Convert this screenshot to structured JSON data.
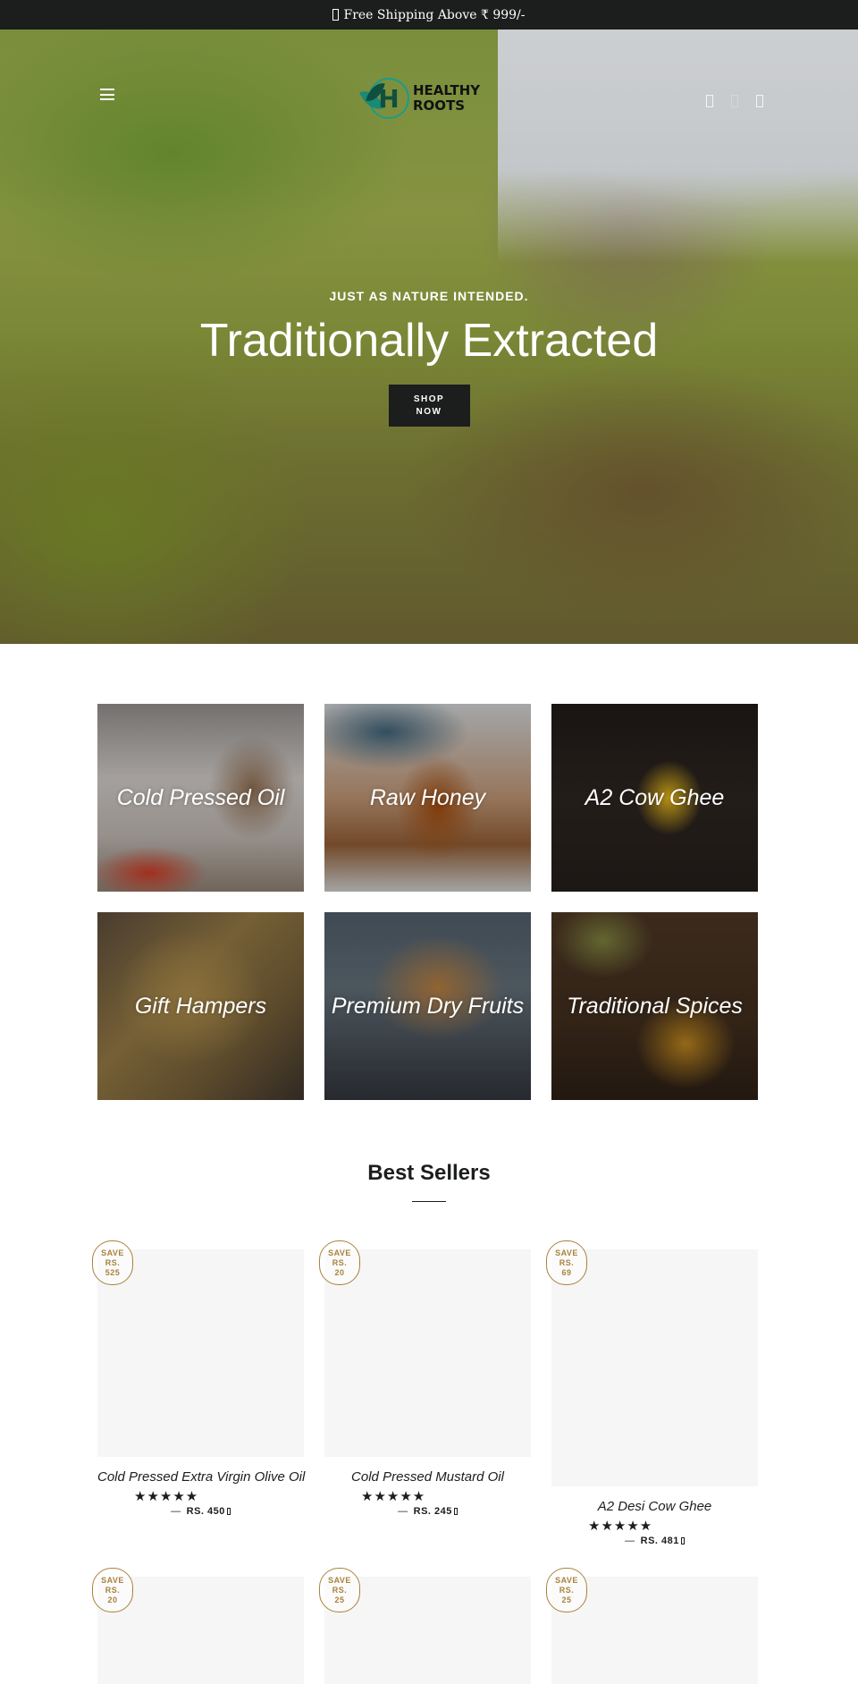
{
  "announcement": {
    "text": "Free Shipping Above ₹ 999/-",
    "icon": "unknown-glyph-icon"
  },
  "header": {
    "brand_line1": "HEALTHY",
    "brand_line2": "ROOTS",
    "logo_letter": "H",
    "icons": [
      "search-icon",
      "account-icon",
      "cart-icon"
    ]
  },
  "hero": {
    "subheading": "JUST AS NATURE INTENDED.",
    "title": "Traditionally Extracted",
    "button_label": "SHOP\nNOW",
    "slides": 3,
    "active_slide": 1
  },
  "collections": [
    {
      "label": "Cold Pressed Oil"
    },
    {
      "label": "Raw Honey"
    },
    {
      "label": "A2 Cow Ghee"
    },
    {
      "label": "Gift Hampers"
    },
    {
      "label": "Premium Dry Fruits"
    },
    {
      "label": "Traditional Spices"
    }
  ],
  "best_sellers": {
    "title": "Best Sellers",
    "products": [
      {
        "badge": [
          "SAVE",
          "RS.",
          "525"
        ],
        "title": "Cold Pressed Extra Virgin Olive Oil",
        "stars": "★★★★★",
        "rating": 5,
        "price": "RS. 450"
      },
      {
        "badge": [
          "SAVE",
          "RS.",
          "20"
        ],
        "title": "Cold Pressed Mustard Oil",
        "stars": "★★★★★",
        "rating": 5,
        "price": "RS. 245"
      },
      {
        "badge": [
          "SAVE",
          "RS.",
          "69"
        ],
        "title": "A2 Desi Cow Ghee",
        "stars": "★★★★★",
        "rating": 5,
        "price": "RS. 481"
      },
      {
        "badge": [
          "SAVE",
          "RS.",
          "20"
        ]
      },
      {
        "badge": [
          "SAVE",
          "RS.",
          "25"
        ]
      },
      {
        "badge": [
          "SAVE",
          "RS.",
          "25"
        ]
      }
    ],
    "price_dash": "—"
  },
  "colors": {
    "dark": "#1c1d1d",
    "badge_gold": "#a9823d",
    "placeholder": "#f6f6f6",
    "logo_teal": "#1d9b8a"
  }
}
